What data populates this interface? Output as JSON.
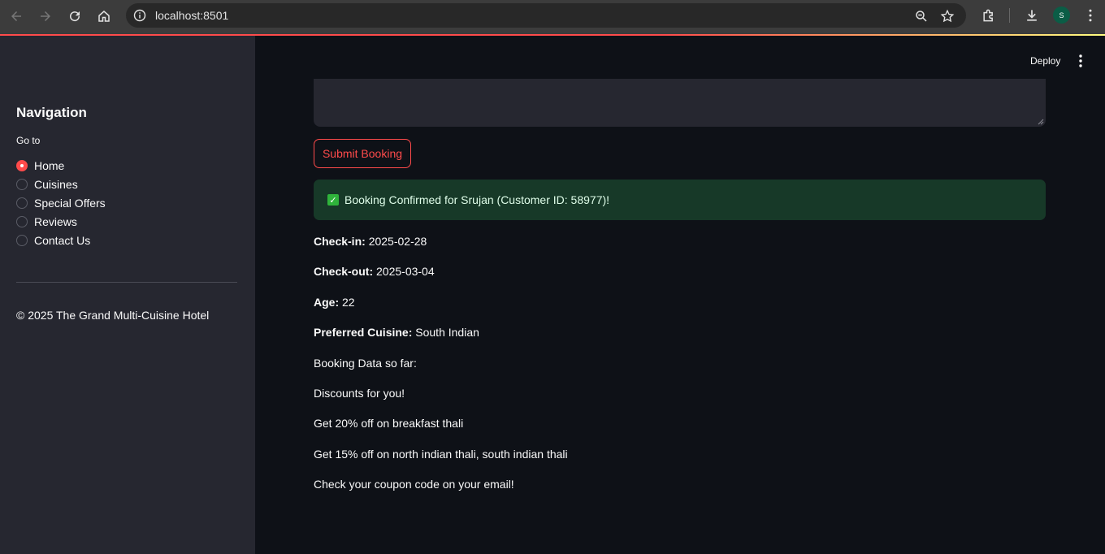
{
  "browser": {
    "url": "localhost:8501",
    "profile_initial": "S"
  },
  "sidebar": {
    "title": "Navigation",
    "radio_label": "Go to",
    "items": [
      {
        "label": "Home",
        "selected": true
      },
      {
        "label": "Cuisines",
        "selected": false
      },
      {
        "label": "Special Offers",
        "selected": false
      },
      {
        "label": "Reviews",
        "selected": false
      },
      {
        "label": "Contact Us",
        "selected": false
      }
    ],
    "footer": "© 2025 The Grand Multi-Cuisine Hotel"
  },
  "header": {
    "deploy_label": "Deploy"
  },
  "form": {
    "textarea_value": "",
    "submit_label": "Submit Booking"
  },
  "confirmation": {
    "message": "Booking Confirmed for Srujan (Customer ID: 58977)!"
  },
  "details": {
    "checkin_label": "Check-in:",
    "checkin_value": "2025-02-28",
    "checkout_label": "Check-out:",
    "checkout_value": "2025-03-04",
    "age_label": "Age:",
    "age_value": "22",
    "cuisine_label": "Preferred Cuisine:",
    "cuisine_value": "South Indian"
  },
  "notes": [
    "Booking Data so far:",
    "Discounts for you!",
    "Get 20% off on breakfast thali",
    "Get 15% off on north indian thali, south indian thali",
    "Check your coupon code on your email!"
  ],
  "colors": {
    "accent": "#ff4b4b",
    "success_bg": "#173928",
    "sidebar_bg": "#262730",
    "main_bg": "#0e1117"
  }
}
